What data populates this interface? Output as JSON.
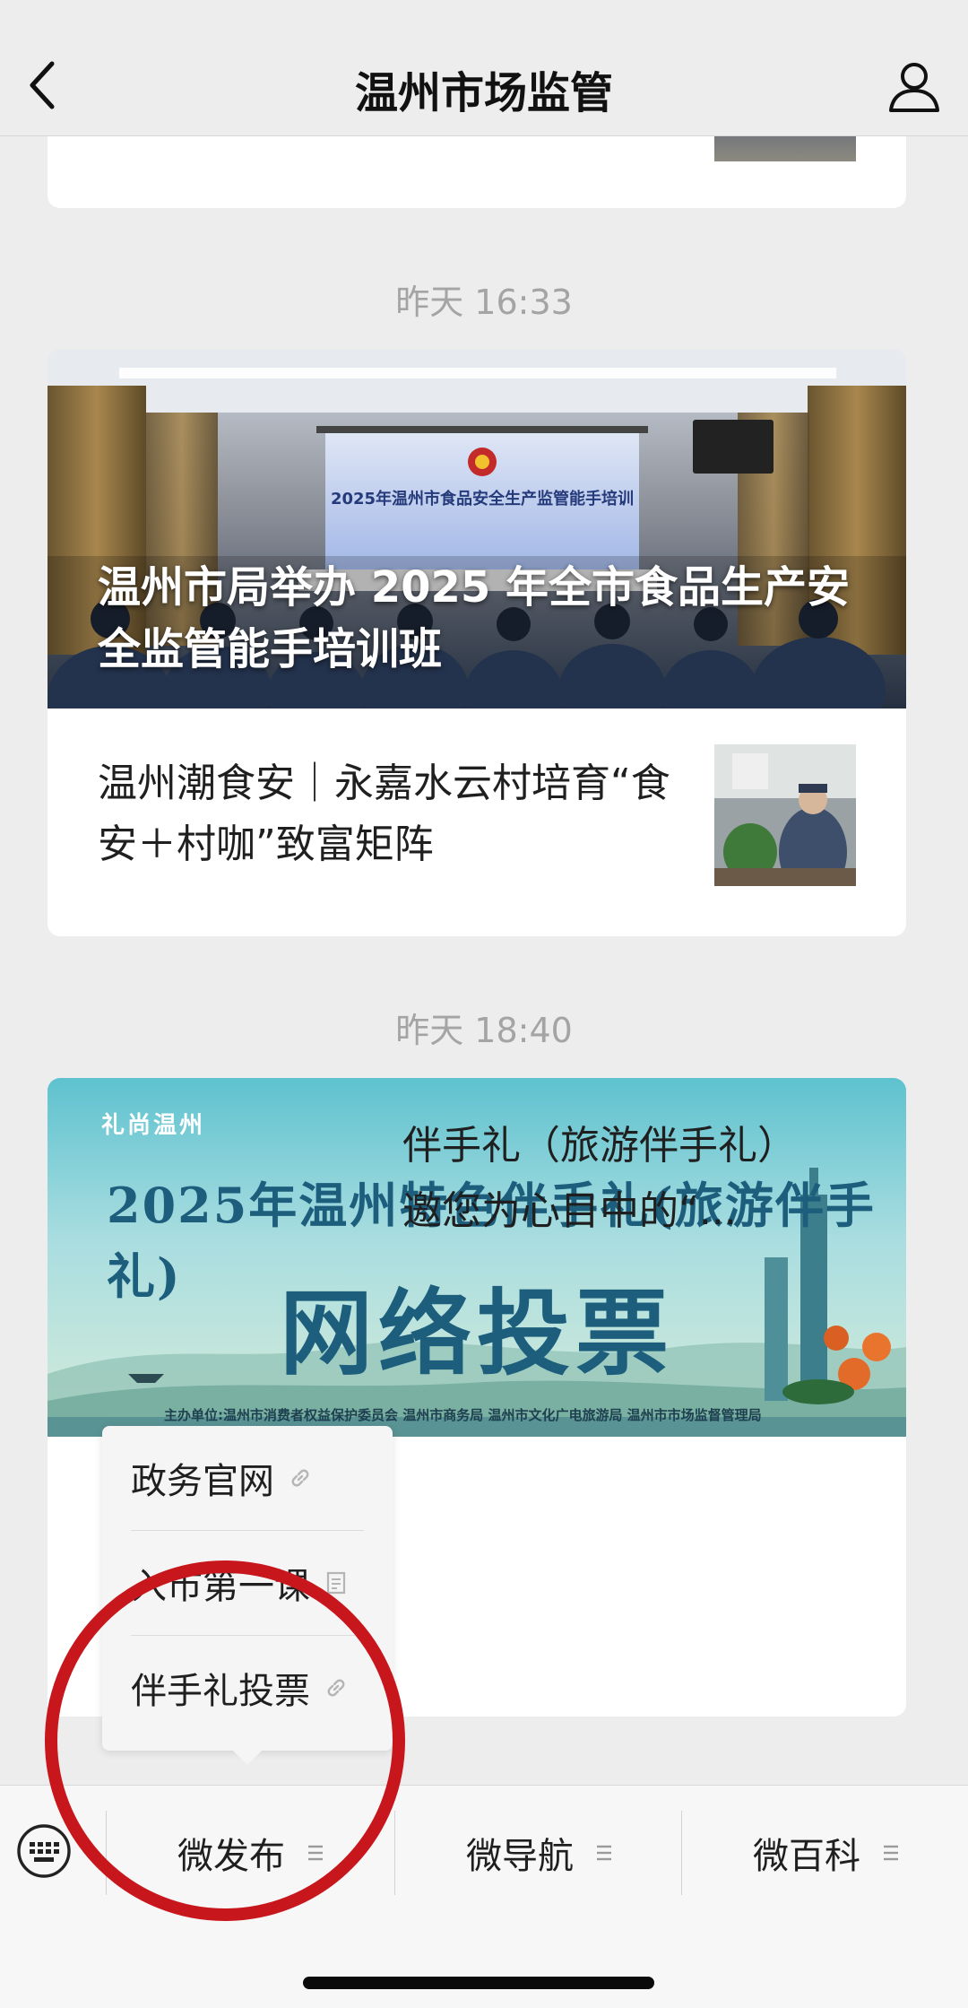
{
  "header": {
    "title": "温州市场监管",
    "back_icon": "chevron-left-icon",
    "profile_icon": "person-icon"
  },
  "feed": {
    "groups": [
      {
        "timestamp": "昨天 16:33",
        "hero_title": "温州市局举办 2025 年全市食品生产安全监管能手培训班",
        "hero_screen_title": "2025年温州市食品安全生产监管能手培训",
        "sub_title": "温州潮食安｜永嘉水云村培育“食安＋村咖”致富矩阵"
      },
      {
        "timestamp": "昨天 18:40",
        "banner_logo": "礼尚温州",
        "banner_line1": "2025年温州特色伴手礼(旅游伴手礼)",
        "banner_line2": "网络投票",
        "banner_sponsors": "主办单位:温州市消费者权益保护委员会   温州市商务局   温州市文化广电旅游局   温州市市场监督管理局",
        "visible_text_line1": "伴手礼（旅游伴手礼）",
        "visible_text_line2": "邀您为心目中的“..."
      }
    ]
  },
  "popup_menu": {
    "items": [
      {
        "label": "政务官网",
        "icon": "link-icon"
      },
      {
        "label": "入市第一课",
        "icon": "document-icon"
      },
      {
        "label": "伴手礼投票",
        "icon": "link-icon"
      }
    ]
  },
  "bottom_menu": {
    "keyboard_icon": "keyboard-icon",
    "tabs": [
      {
        "label": "微发布",
        "icon": "menu-lines-icon"
      },
      {
        "label": "微导航",
        "icon": "menu-lines-icon"
      },
      {
        "label": "微百科",
        "icon": "menu-lines-icon"
      }
    ]
  },
  "colors": {
    "background": "#ededed",
    "card": "#ffffff",
    "annotation_circle": "#c8161d",
    "timestamp": "#a4a4a4"
  }
}
